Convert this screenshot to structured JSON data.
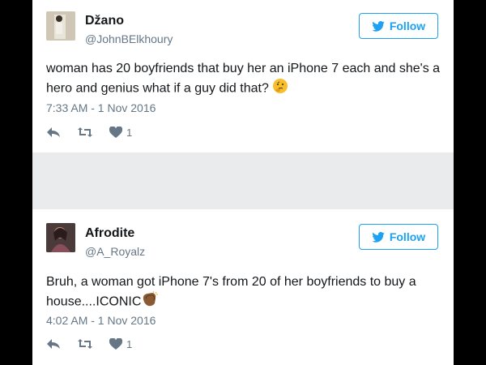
{
  "tweets": [
    {
      "name": "Džano",
      "handle": "@JohnBElkhoury",
      "follow_label": "Follow",
      "text": "woman has 20 boyfriends that buy her an iPhone 7 each and she's a hero and genius what if a guy did that?",
      "emoji": "thinking-face",
      "time": "7:33 AM - 1 Nov 2016",
      "like_count": "1"
    },
    {
      "name": "Afrodite",
      "handle": "@A_Royalz",
      "follow_label": "Follow",
      "text": "Bruh, a woman got iPhone 7's from 20 of her boyfriends to buy a house....ICONIC",
      "emoji": "clapping-hands",
      "time": "4:02 AM - 1 Nov 2016",
      "like_count": "1"
    }
  ],
  "colors": {
    "accent": "#1da1f2",
    "muted": "#657786",
    "text": "#14171a",
    "divider": "#e9ebed"
  }
}
